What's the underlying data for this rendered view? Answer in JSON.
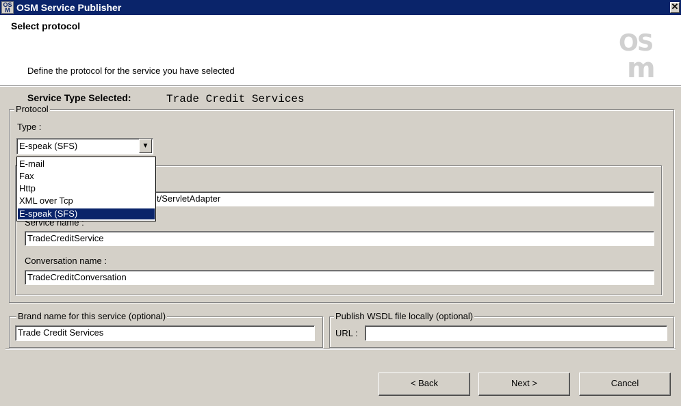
{
  "window": {
    "title": "OSM Service Publisher",
    "close_glyph": "✕",
    "icon": "osm-app-icon",
    "icon_text": "OS M"
  },
  "header": {
    "title": "Select protocol",
    "subtitle": "Define the protocol for the service you have selected",
    "logo_top": "OS",
    "logo_bottom": "m"
  },
  "service_type": {
    "label": "Service Type Selected:",
    "value": "Trade Credit Services"
  },
  "protocol": {
    "legend": "Protocol",
    "type_label": "Type :",
    "selected": "E-speak (SFS)",
    "options": [
      "E-mail",
      "Fax",
      "Http",
      "XML over Tcp",
      "E-speak (SFS)"
    ],
    "endpoint_value_visible": "t/ServletAdapter",
    "service_name_label": "Service name :",
    "service_name_value": "TradeCreditService",
    "conversation_label": "Conversation name :",
    "conversation_value": "TradeCreditConversation"
  },
  "brand": {
    "legend": "Brand name for this service (optional)",
    "value": "Trade Credit Services"
  },
  "wsdl": {
    "legend": "Publish WSDL file locally (optional)",
    "url_label": "URL :",
    "url_value": ""
  },
  "buttons": {
    "back": "< Back",
    "next": "Next >",
    "cancel": "Cancel"
  }
}
